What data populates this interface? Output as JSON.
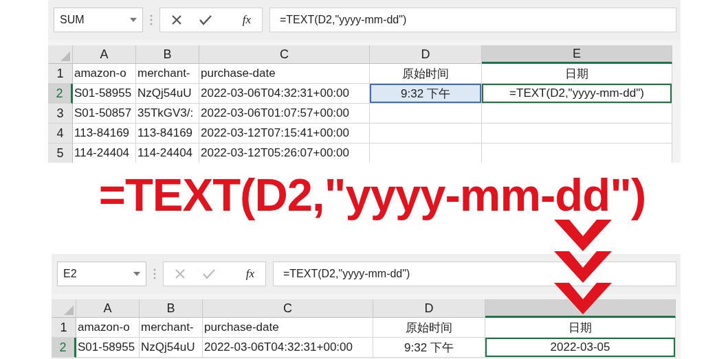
{
  "top_sheet": {
    "name_box": "SUM",
    "editing": true,
    "function_label": "fx",
    "formula": "=TEXT(D2,\"yyyy-mm-dd\")",
    "columns": [
      {
        "label": "A",
        "selected": false
      },
      {
        "label": "B",
        "selected": false
      },
      {
        "label": "C",
        "selected": false
      },
      {
        "label": "D",
        "selected": false
      },
      {
        "label": "E",
        "selected": true
      }
    ],
    "rows": [
      {
        "number": "1",
        "selected": false,
        "cells": [
          {
            "text": "amazon-o",
            "active": false,
            "referenced": false
          },
          {
            "text": "merchant-",
            "active": false,
            "referenced": false
          },
          {
            "text": "purchase-date",
            "active": false,
            "referenced": false
          },
          {
            "text": "原始时间",
            "active": false,
            "referenced": false
          },
          {
            "text": "日期",
            "active": false,
            "referenced": false
          }
        ]
      },
      {
        "number": "2",
        "selected": true,
        "cells": [
          {
            "text": "S01-58955",
            "active": false,
            "referenced": false
          },
          {
            "text": "NzQj54uU",
            "active": false,
            "referenced": false
          },
          {
            "text": "2022-03-06T04:32:31+00:00",
            "active": false,
            "referenced": false
          },
          {
            "text": "9:32 下午",
            "active": false,
            "referenced": true
          },
          {
            "text": "=TEXT(D2,\"yyyy-mm-dd\")",
            "active": true,
            "referenced": false
          }
        ]
      },
      {
        "number": "3",
        "selected": false,
        "cells": [
          {
            "text": "S01-50857",
            "active": false,
            "referenced": false
          },
          {
            "text": "35TkGV3/:",
            "active": false,
            "referenced": false
          },
          {
            "text": "2022-03-06T01:07:57+00:00",
            "active": false,
            "referenced": false
          },
          {
            "active": false,
            "referenced": false
          },
          {
            "active": false,
            "referenced": false
          }
        ]
      },
      {
        "number": "4",
        "selected": false,
        "cells": [
          {
            "text": "113-84169",
            "active": false,
            "referenced": false
          },
          {
            "text": "113-84169",
            "active": false,
            "referenced": false
          },
          {
            "text": "2022-03-12T07:15:41+00:00",
            "active": false,
            "referenced": false
          },
          {
            "active": false,
            "referenced": false
          },
          {
            "active": false,
            "referenced": false
          }
        ]
      },
      {
        "number": "5",
        "selected": false,
        "cells": [
          {
            "text": "114-24404",
            "active": false,
            "referenced": false
          },
          {
            "text": "114-24404",
            "active": false,
            "referenced": false
          },
          {
            "text": "2022-03-12T05:26:07+00:00",
            "active": false,
            "referenced": false
          },
          {
            "active": false,
            "referenced": false
          },
          {
            "active": false,
            "referenced": false
          }
        ]
      }
    ]
  },
  "headline": "=TEXT(D2,\"yyyy-mm-dd\")",
  "bottom_sheet": {
    "name_box": "E2",
    "editing": false,
    "function_label": "fx",
    "formula": "=TEXT(D2,\"yyyy-mm-dd\")",
    "columns": [
      {
        "label": "A",
        "selected": false
      },
      {
        "label": "B",
        "selected": false
      },
      {
        "label": "C",
        "selected": false
      },
      {
        "label": "D",
        "selected": false
      },
      {
        "selected": true
      }
    ],
    "rows": [
      {
        "number": "1",
        "selected": false,
        "cells": [
          {
            "text": "amazon-o",
            "active": false,
            "referenced": false
          },
          {
            "text": "merchant-",
            "active": false,
            "referenced": false
          },
          {
            "text": "purchase-date",
            "active": false,
            "referenced": false
          },
          {
            "text": "原始时间",
            "active": false,
            "referenced": false
          },
          {
            "text": "日期",
            "active": false,
            "referenced": false
          }
        ]
      },
      {
        "number": "2",
        "selected": true,
        "cells": [
          {
            "text": "S01-58955",
            "active": false,
            "referenced": false
          },
          {
            "text": "NzQj54uU",
            "active": false,
            "referenced": false
          },
          {
            "text": "2022-03-06T04:32:31+00:00",
            "active": false,
            "referenced": false
          },
          {
            "text": "9:32 下午",
            "active": false,
            "referenced": false
          },
          {
            "text": "2022-03-05",
            "active": true,
            "referenced": false
          }
        ]
      }
    ]
  }
}
